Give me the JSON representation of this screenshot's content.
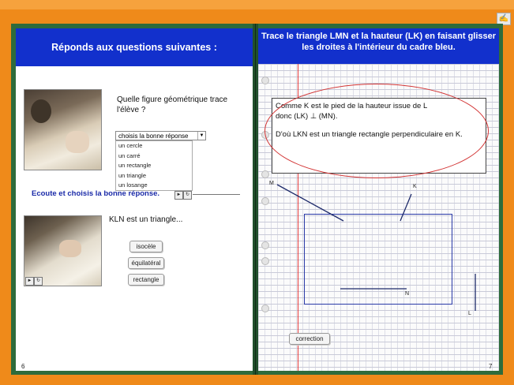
{
  "left_page": {
    "header": "Réponds aux questions suivantes :",
    "question1": "Quelle figure géométrique trace l'élève ?",
    "select_value": "choisis la bonne réponse",
    "options": [
      "un cercle",
      "un carré",
      "un rectangle",
      "un triangle",
      "un losange"
    ],
    "ecoute_label": "Ecoute et choisis la bonne réponse.",
    "question2": "KLN est un triangle...",
    "choices": [
      "isocèle",
      "équilatéral",
      "rectangle"
    ],
    "page_number": "6"
  },
  "right_page": {
    "header": "Trace le triangle LMN et la hauteur (LK) en faisant glisser les droites à l'intérieur du cadre bleu.",
    "answer_line1": "Comme K est le pied de la hauteur issue de L",
    "answer_line2": "donc (LK) ⊥ (MN).",
    "answer_line3": "D'où LKN est un triangle rectangle perpendiculaire en K.",
    "label_m": "M",
    "label_k": "K",
    "label_n": "N",
    "label_l": "L",
    "correction_button": "correction",
    "page_number": "7"
  },
  "controls": {
    "play_icon": "►",
    "replay_icon": "↻",
    "corner_icon": "✍"
  }
}
